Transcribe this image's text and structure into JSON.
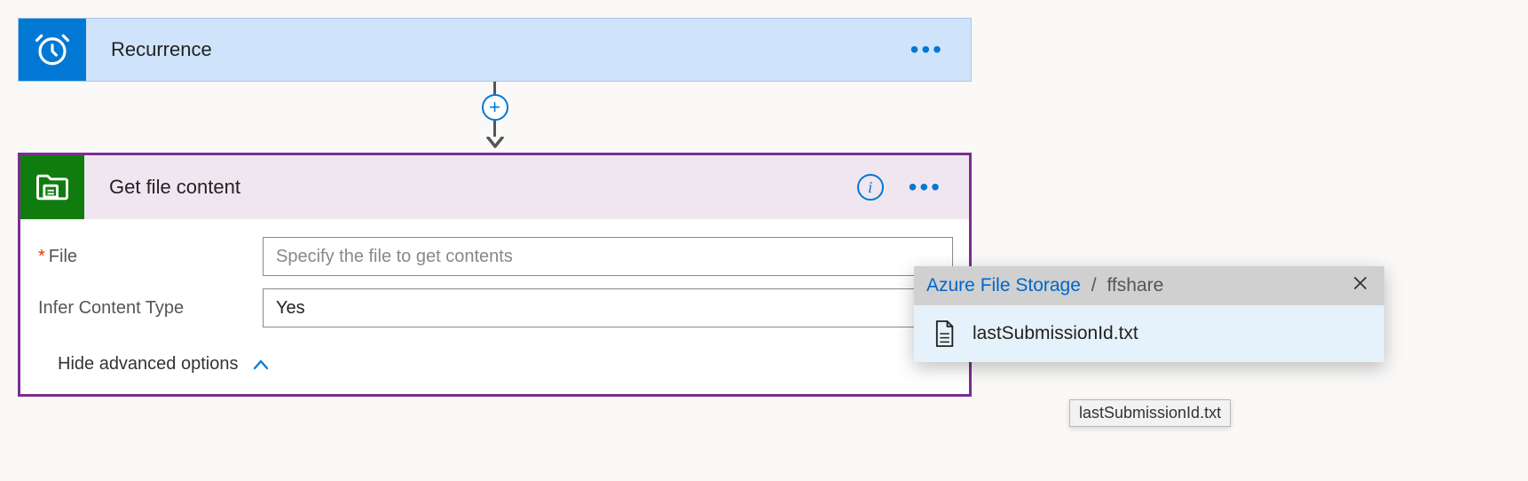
{
  "trigger": {
    "title": "Recurrence"
  },
  "action": {
    "title": "Get file content",
    "fields": {
      "file": {
        "label": "File",
        "required_marker": "*",
        "placeholder": "Specify the file to get contents",
        "value": ""
      },
      "infer_content_type": {
        "label": "Infer Content Type",
        "value": "Yes"
      }
    },
    "advanced_toggle_label": "Hide advanced options"
  },
  "file_picker": {
    "breadcrumb_root": "Azure File Storage",
    "breadcrumb_sep": "/",
    "breadcrumb_share": "ffshare",
    "items": [
      {
        "name": "lastSubmissionId.txt"
      }
    ]
  },
  "tooltip": {
    "text": "lastSubmissionId.txt"
  }
}
